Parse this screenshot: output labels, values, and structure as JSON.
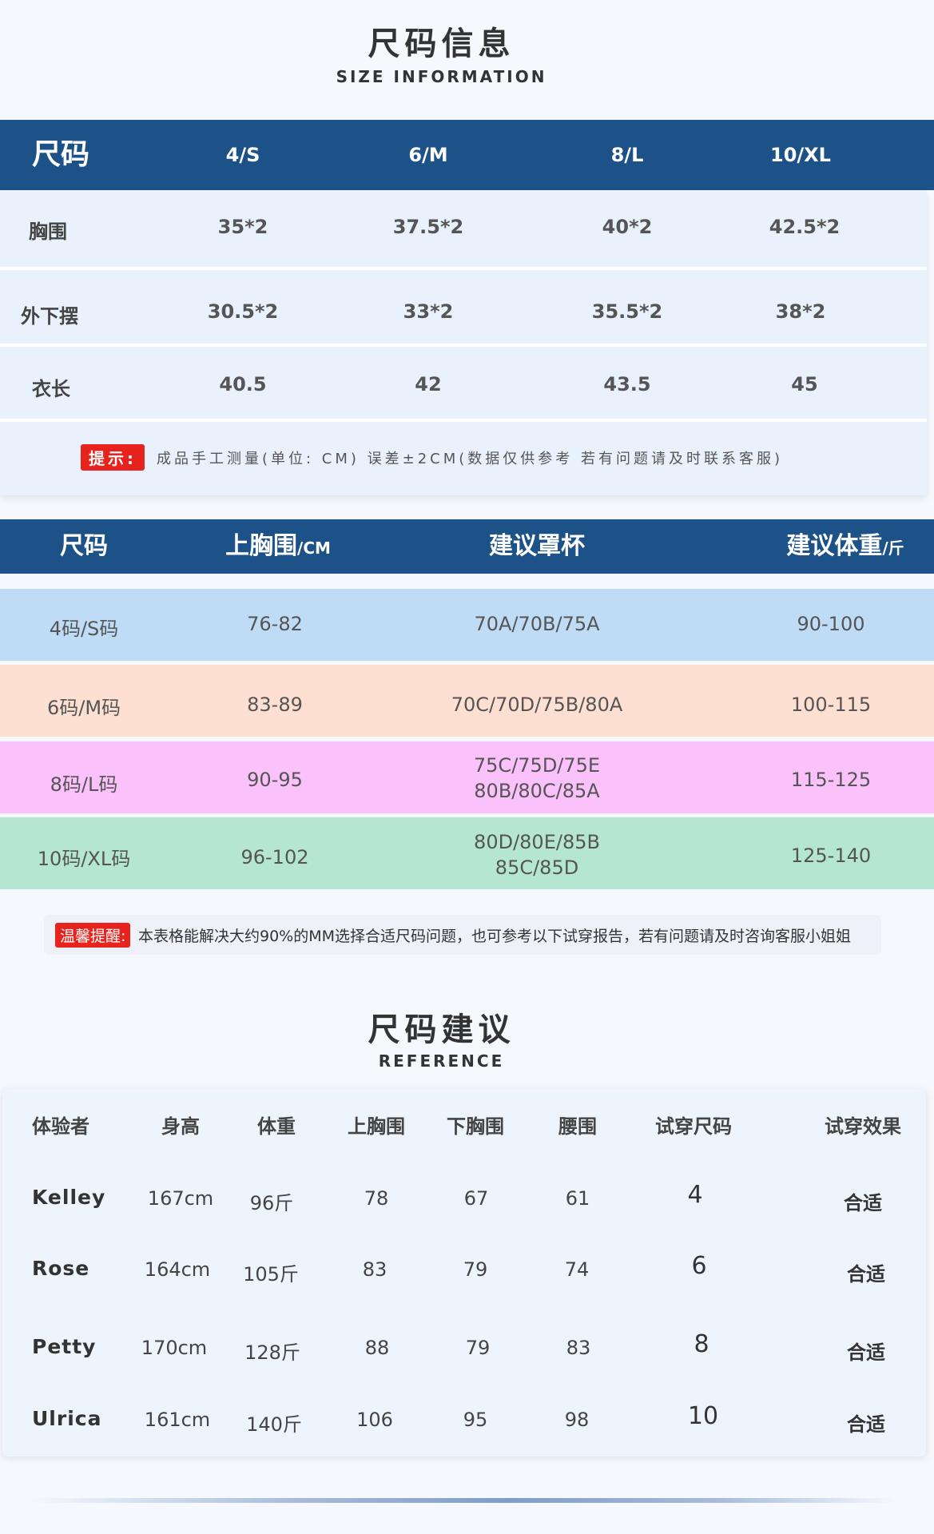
{
  "size_info": {
    "title": "尺码信息",
    "subtitle": "SIZE INFORMATION",
    "header": [
      "尺码",
      "4/S",
      "6/M",
      "8/L",
      "10/XL"
    ],
    "rows": [
      {
        "label": "胸围",
        "values": [
          "35*2",
          "37.5*2",
          "40*2",
          "42.5*2"
        ]
      },
      {
        "label": "外下摆",
        "values": [
          "30.5*2",
          "33*2",
          "35.5*2",
          "38*2"
        ]
      },
      {
        "label": "衣长",
        "values": [
          "40.5",
          "42",
          "43.5",
          "45"
        ]
      }
    ],
    "tip_label": "提示:",
    "tip_text": "成品手工测量(单位: CM) 误差±2CM(数据仅供参考  若有问题请及时联系客服)"
  },
  "cup_table": {
    "header": {
      "size": "尺码",
      "bust": "上胸围",
      "bust_unit": "/CM",
      "cup": "建议罩杯",
      "weight": "建议体重",
      "weight_unit": "/斤"
    },
    "rows": [
      {
        "size": "4码/S码",
        "bust": "76-82",
        "cup_line1": "70A/70B/75A",
        "cup_line2": "",
        "weight": "90-100",
        "color": "#bedcf5"
      },
      {
        "size": "6码/M码",
        "bust": "83-89",
        "cup_line1": "70C/70D/75B/80A",
        "cup_line2": "",
        "weight": "100-115",
        "color": "#fde0d2"
      },
      {
        "size": "8码/L码",
        "bust": "90-95",
        "cup_line1": "75C/75D/75E",
        "cup_line2": "80B/80C/85A",
        "weight": "115-125",
        "color": "#fbc1fb"
      },
      {
        "size": "10码/XL码",
        "bust": "96-102",
        "cup_line1": "80D/80E/85B",
        "cup_line2": "85C/85D",
        "weight": "125-140",
        "color": "#b4e6d2"
      }
    ]
  },
  "note": {
    "label": "温馨提醒:",
    "text": "本表格能解决大约90%的MM选择合适尺码问题，也可参考以下试穿报告，若有问题请及时咨询客服小姐姐"
  },
  "reference": {
    "title": "尺码建议",
    "subtitle": "REFERENCE",
    "header": [
      "体验者",
      "身高",
      "体重",
      "上胸围",
      "下胸围",
      "腰围",
      "试穿尺码",
      "试穿效果"
    ],
    "rows": [
      {
        "name": "Kelley",
        "height": "167cm",
        "weight": "96斤",
        "upper_bust": "78",
        "under_bust": "67",
        "waist": "61",
        "size": "4",
        "effect": "合适"
      },
      {
        "name": "Rose",
        "height": "164cm",
        "weight": "105斤",
        "upper_bust": "83",
        "under_bust": "79",
        "waist": "74",
        "size": "6",
        "effect": "合适"
      },
      {
        "name": "Petty",
        "height": "170cm",
        "weight": "128斤",
        "upper_bust": "88",
        "under_bust": "79",
        "waist": "83",
        "size": "8",
        "effect": "合适"
      },
      {
        "name": "Ulrica",
        "height": "161cm",
        "weight": "140斤",
        "upper_bust": "106",
        "under_bust": "95",
        "waist": "98",
        "size": "10",
        "effect": "合适"
      }
    ]
  },
  "colors": {
    "header_blue": "#1d5288",
    "tip_red": "#e8231d"
  }
}
